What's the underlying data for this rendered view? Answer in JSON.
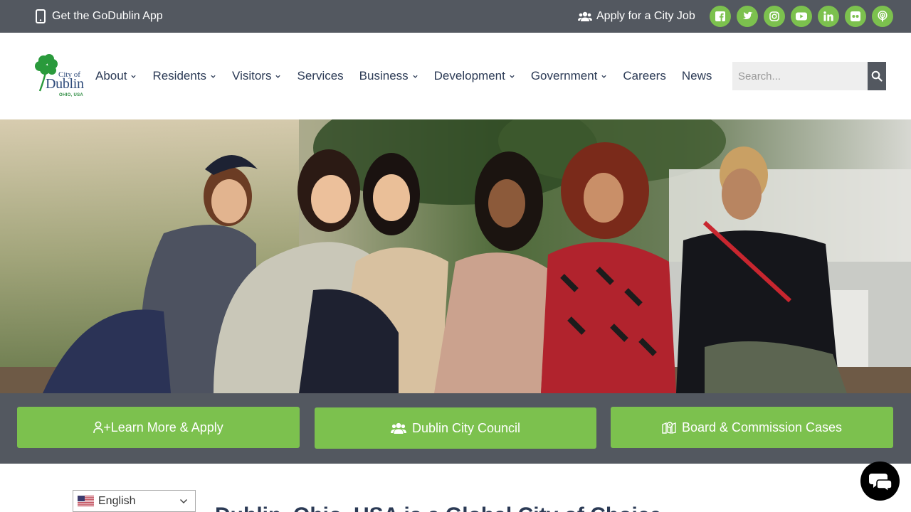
{
  "topbar": {
    "app_label": "Get the GoDublin App",
    "job_label": "Apply for a City Job",
    "socials": [
      "facebook-icon",
      "twitter-icon",
      "instagram-icon",
      "youtube-icon",
      "linkedin-icon",
      "flickr-icon",
      "podcast-icon"
    ]
  },
  "logo": {
    "city_of": "City of",
    "name": "Dublin",
    "state": "OHIO, USA"
  },
  "nav": {
    "items": [
      {
        "label": "About",
        "dropdown": true
      },
      {
        "label": "Residents",
        "dropdown": true
      },
      {
        "label": "Visitors",
        "dropdown": true
      },
      {
        "label": "Services",
        "dropdown": false
      },
      {
        "label": "Business",
        "dropdown": true
      },
      {
        "label": "Development",
        "dropdown": true
      },
      {
        "label": "Government",
        "dropdown": true
      },
      {
        "label": "Careers",
        "dropdown": false
      },
      {
        "label": "News",
        "dropdown": false
      }
    ]
  },
  "search": {
    "placeholder": "Search..."
  },
  "cta": {
    "learn_more": "+Learn More & Apply",
    "council": "Dublin City Council",
    "board": "Board & Commission Cases"
  },
  "language": {
    "selected": "English"
  },
  "section": {
    "heading_partial": "Dublin, Ohio, USA is a Global City of Choice"
  },
  "colors": {
    "topbar": "#535860",
    "accent_green": "#7cc14e",
    "nav_text": "#2b3a55"
  }
}
